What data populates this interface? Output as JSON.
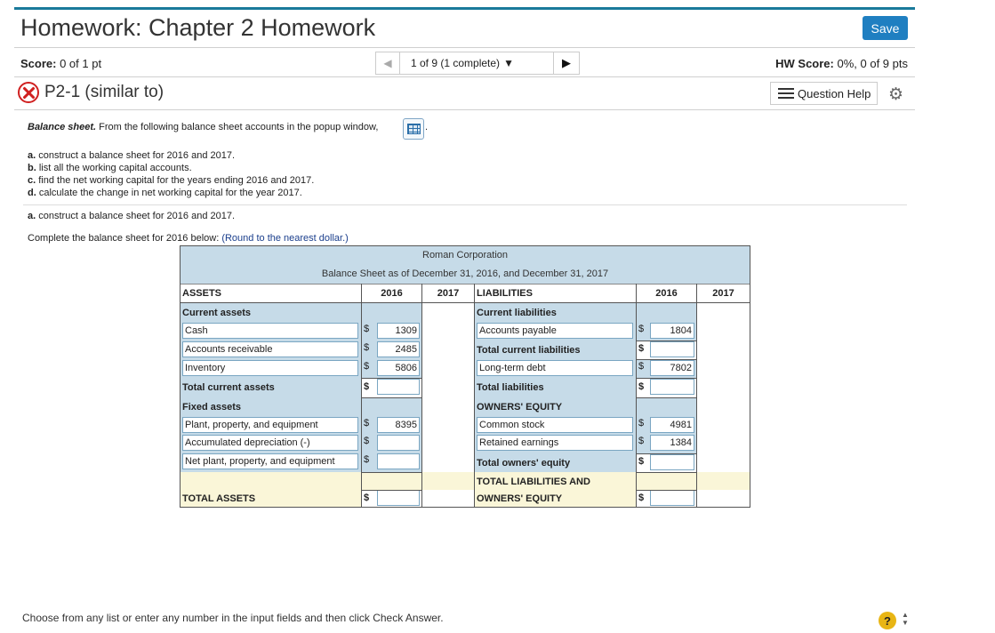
{
  "header": {
    "title": "Homework: Chapter 2 Homework",
    "save_label": "Save",
    "score_label": "Score:",
    "score_value": "0 of 1 pt",
    "hw_score_label": "HW Score:",
    "hw_score_value": "0%, 0 of 9 pts",
    "pager": {
      "text": "1 of 9 (1 complete)",
      "caret": "▼",
      "prev": "◀",
      "next": "▶"
    }
  },
  "question": {
    "id": "P2-1 (similar to)",
    "help_label": "Question Help",
    "intro_bold": "Balance sheet.",
    "intro_text": "From the following balance sheet accounts in the popup window,",
    "intro_after": ".",
    "tasks": [
      {
        "letter": "a.",
        "text": "construct a balance sheet for 2016 and 2017."
      },
      {
        "letter": "b.",
        "text": "list all the working capital accounts."
      },
      {
        "letter": "c.",
        "text": "find the net working capital for the years ending 2016 and 2017."
      },
      {
        "letter": "d.",
        "text": "calculate the change in net working capital for the year 2017."
      }
    ],
    "part_a_letter": "a.",
    "part_a_text": "construct a balance sheet for 2016 and 2017.",
    "complete_text": "Complete the balance sheet for 2016 below:",
    "round_text": "(Round to the nearest dollar.)"
  },
  "balance_sheet": {
    "company": "Roman Corporation",
    "subtitle": "Balance Sheet as of December 31, 2016, and December 31, 2017",
    "col_assets": "ASSETS",
    "col_liabilities": "LIABILITIES",
    "year1": "2016",
    "year2": "2017",
    "dollar": "$",
    "left": {
      "current_assets": "Current assets",
      "cash": "Cash",
      "cash_2016": "1309",
      "ar": "Accounts receivable",
      "ar_2016": "2485",
      "inventory": "Inventory",
      "inventory_2016": "5806",
      "total_current": "Total current assets",
      "total_current_2016": "",
      "fixed_assets": "Fixed assets",
      "ppe": "Plant, property, and equipment",
      "ppe_2016": "8395",
      "accum_dep": "Accumulated depreciation (-)",
      "accum_dep_2016": "",
      "net_ppe": "Net plant, property, and equipment",
      "net_ppe_2016": "",
      "total_assets": "TOTAL ASSETS",
      "total_assets_2016": ""
    },
    "right": {
      "current_liabilities": "Current liabilities",
      "ap": "Accounts payable",
      "ap_2016": "1804",
      "total_current": "Total current liabilities",
      "total_current_2016": "",
      "ltd": "Long-term debt",
      "ltd_2016": "7802",
      "total_liabilities": "Total liabilities",
      "total_liabilities_2016": "",
      "owners_equity": "OWNERS' EQUITY",
      "common": "Common stock",
      "common_2016": "4981",
      "retained": "Retained earnings",
      "retained_2016": "1384",
      "total_oe": "Total owners' equity",
      "total_oe_2016": "",
      "total_lo_1": "TOTAL LIABILITIES AND",
      "total_lo_2": "OWNERS' EQUITY",
      "total_lo_2016": ""
    }
  },
  "footer": {
    "instruction": "Choose from any list or enter any number in the input fields and then click Check Answer.",
    "help_glyph": "?",
    "spin_up": "▲",
    "spin_down": "▼"
  }
}
